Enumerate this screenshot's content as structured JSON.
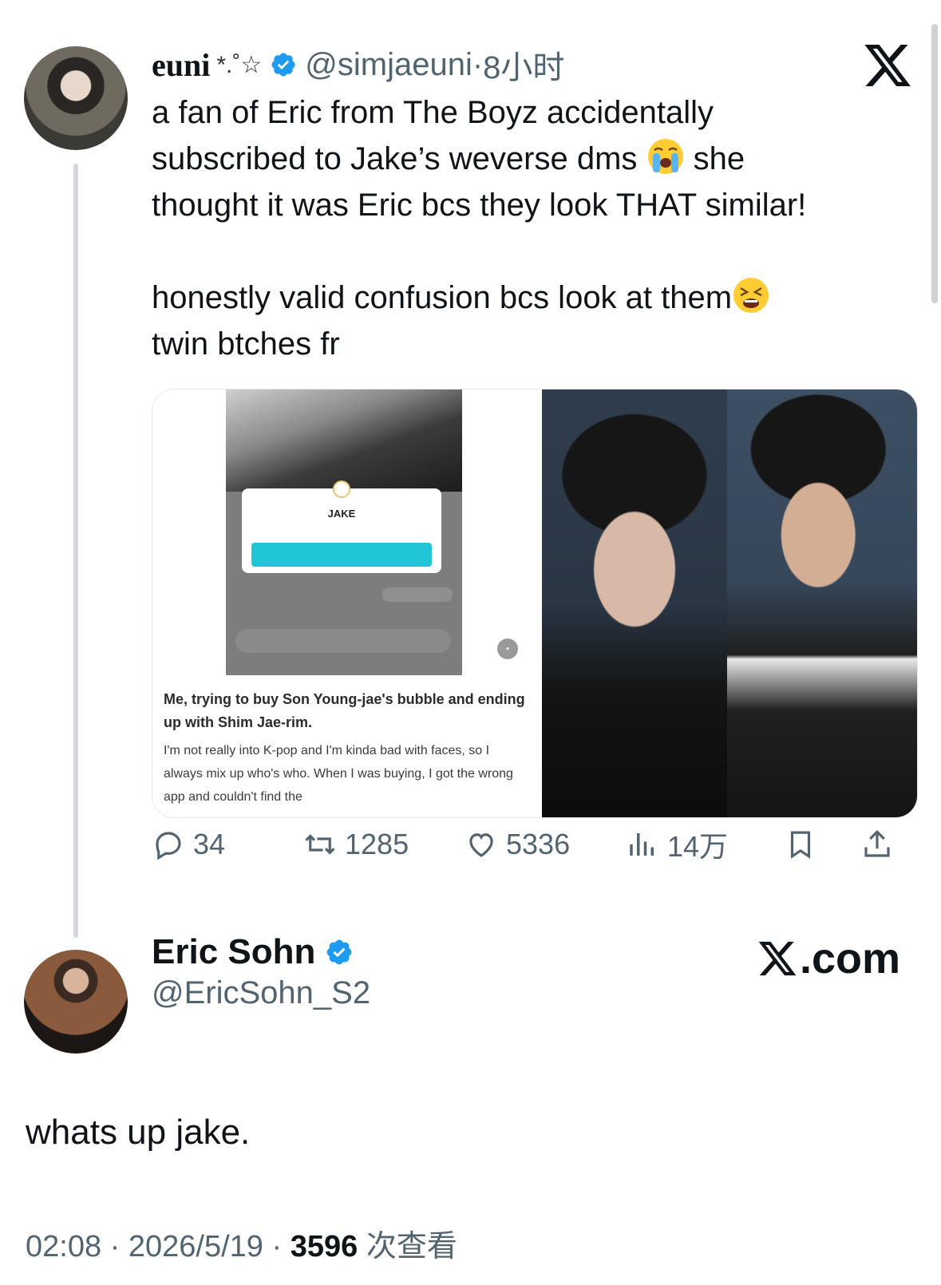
{
  "tweet": {
    "author": {
      "display_name": "euni",
      "name_decoration": "*.˚☆",
      "handle": "@simjaeuni",
      "separator": " · ",
      "time_ago": "8小时"
    },
    "text_line1": "a fan of Eric from The Boyz accidentally",
    "text_line2a": "subscribed to Jake’s weverse dms ",
    "text_line2b": " she",
    "text_line3": "thought it was Eric bcs they look THAT similar!",
    "text_line4": "honestly valid confusion bcs look at them",
    "text_line5": "twin btches fr",
    "emoji_1": "loudly-crying-face-emoji",
    "emoji_2": "tired-face-emoji",
    "media": {
      "card_label": "JAKE",
      "caption_title": "Me, trying to buy Son Young-jae's bubble and ending up with Shim Jae-rim.",
      "caption_body": "I'm not really into K-pop and I'm kinda bad with faces, so I always mix up who's who. When I was buying, I got the wrong app and couldn't find the"
    },
    "stats": {
      "replies": "34",
      "retweets": "1285",
      "likes": "5336",
      "views": "14万"
    }
  },
  "reply": {
    "display_name": "Eric Sohn",
    "handle": "@EricSohn_S2",
    "site_label": ".com",
    "text": "whats up jake.",
    "time": "02:08",
    "date": "2026/5/19",
    "view_count": "3596",
    "view_label": "次查看"
  },
  "colors": {
    "verified_blue": "#1d9bf0",
    "secondary_text": "#536471",
    "primary_text": "#0f1419",
    "thread_line": "#d3d9de"
  }
}
